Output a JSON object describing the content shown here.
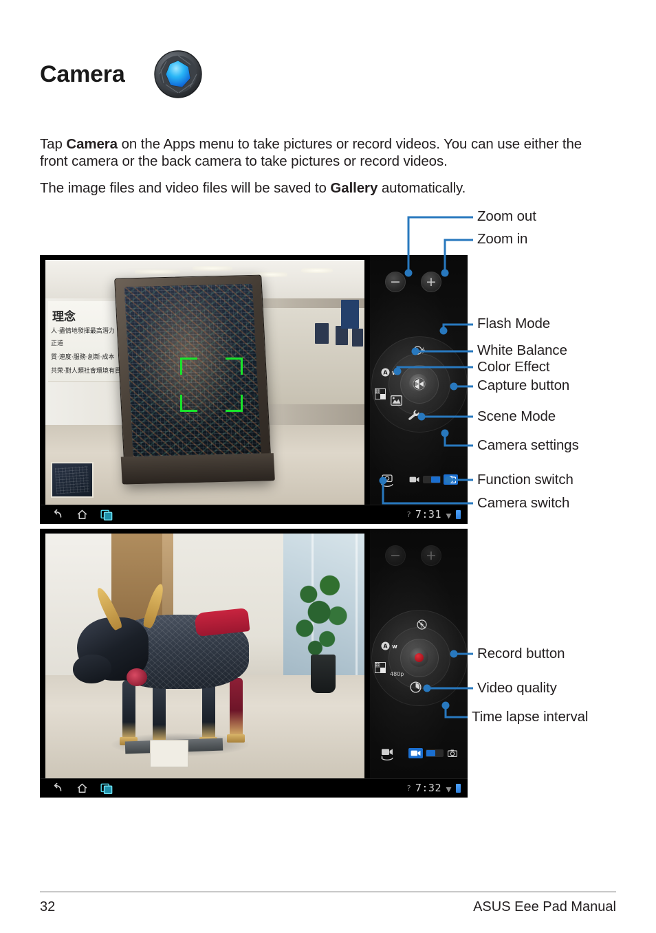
{
  "header": {
    "title": "Camera",
    "icon": "camera-aperture-icon"
  },
  "body": {
    "paragraph_1_before": "Tap ",
    "paragraph_1_bold": "Camera",
    "paragraph_1_after": " on the Apps menu to take pictures or record videos. You can use either the front camera or the back camera to take pictures or record videos.",
    "paragraph_2_before": "The image files and video files will be saved to ",
    "paragraph_2_bold": "Gallery",
    "paragraph_2_after": " automatically."
  },
  "figure_photo": {
    "caption_labels": [
      {
        "id": "zoom-out",
        "label": "Zoom out"
      },
      {
        "id": "zoom-in",
        "label": "Zoom in"
      },
      {
        "id": "flash-mode",
        "label": "Flash Mode"
      },
      {
        "id": "white-balance",
        "label": "White Balance"
      },
      {
        "id": "color-effect",
        "label": "Color Effect"
      },
      {
        "id": "capture-button",
        "label": "Capture button"
      },
      {
        "id": "scene-mode",
        "label": "Scene Mode"
      },
      {
        "id": "camera-settings",
        "label": "Camera settings"
      },
      {
        "id": "function-switch",
        "label": "Function switch"
      },
      {
        "id": "camera-switch",
        "label": "Camera switch"
      }
    ],
    "controls": {
      "zoom_out_glyph": "−",
      "zoom_in_glyph": "+",
      "flash_mode_glyph": "Ⓐ⚡",
      "white_balance_glyph": "Ⓐw",
      "color_effect_glyph": "color-effect-icon",
      "scene_mode_glyph": "scene-mode-icon",
      "settings_glyph": "wrench-icon",
      "capture_glyph": "aperture-icon"
    },
    "status_bar": {
      "back_icon": "back-arrow-icon",
      "home_icon": "home-icon",
      "recent_icon": "recent-apps-icon",
      "question_glyph": "?",
      "clock": "7:31",
      "wifi_icon": "wifi-icon",
      "battery_icon": "battery-icon"
    },
    "scene": {
      "wall_text_lines": [
        "理念",
        "人·盡情地發揮最高潛力",
        "正道",
        "質·速度·服務·創新·成本",
        "共荣·對人類社會環境有貢獻"
      ],
      "focus_brackets": "green-focus-brackets",
      "thumbnail": "last-photo-thumbnail"
    }
  },
  "figure_video": {
    "caption_labels": [
      {
        "id": "record-button",
        "label": "Record button"
      },
      {
        "id": "video-quality",
        "label": "Video quality"
      },
      {
        "id": "time-lapse-interval",
        "label": "Time lapse interval"
      }
    ],
    "controls": {
      "flash_off_glyph": "flash-off-icon",
      "white_balance_glyph": "Ⓐw",
      "color_effect_glyph": "color-effect-icon",
      "video_quality_value": "480p",
      "time_lapse_glyph": "time-lapse-clock-icon",
      "record_glyph": "record-dot-icon"
    },
    "status_bar": {
      "back_icon": "back-arrow-icon",
      "home_icon": "home-icon",
      "recent_icon": "recent-apps-icon",
      "question_glyph": "?",
      "clock": "7:32",
      "wifi_icon": "wifi-icon",
      "battery_icon": "battery-icon"
    }
  },
  "footer": {
    "page_number": "32",
    "manual_title": "ASUS Eee Pad Manual"
  },
  "colors": {
    "callout_blue": "#2878BE",
    "focus_green": "#19E52B",
    "record_red": "#C01A24",
    "switch_blue": "#1B6FD0",
    "text": "#231F20"
  }
}
